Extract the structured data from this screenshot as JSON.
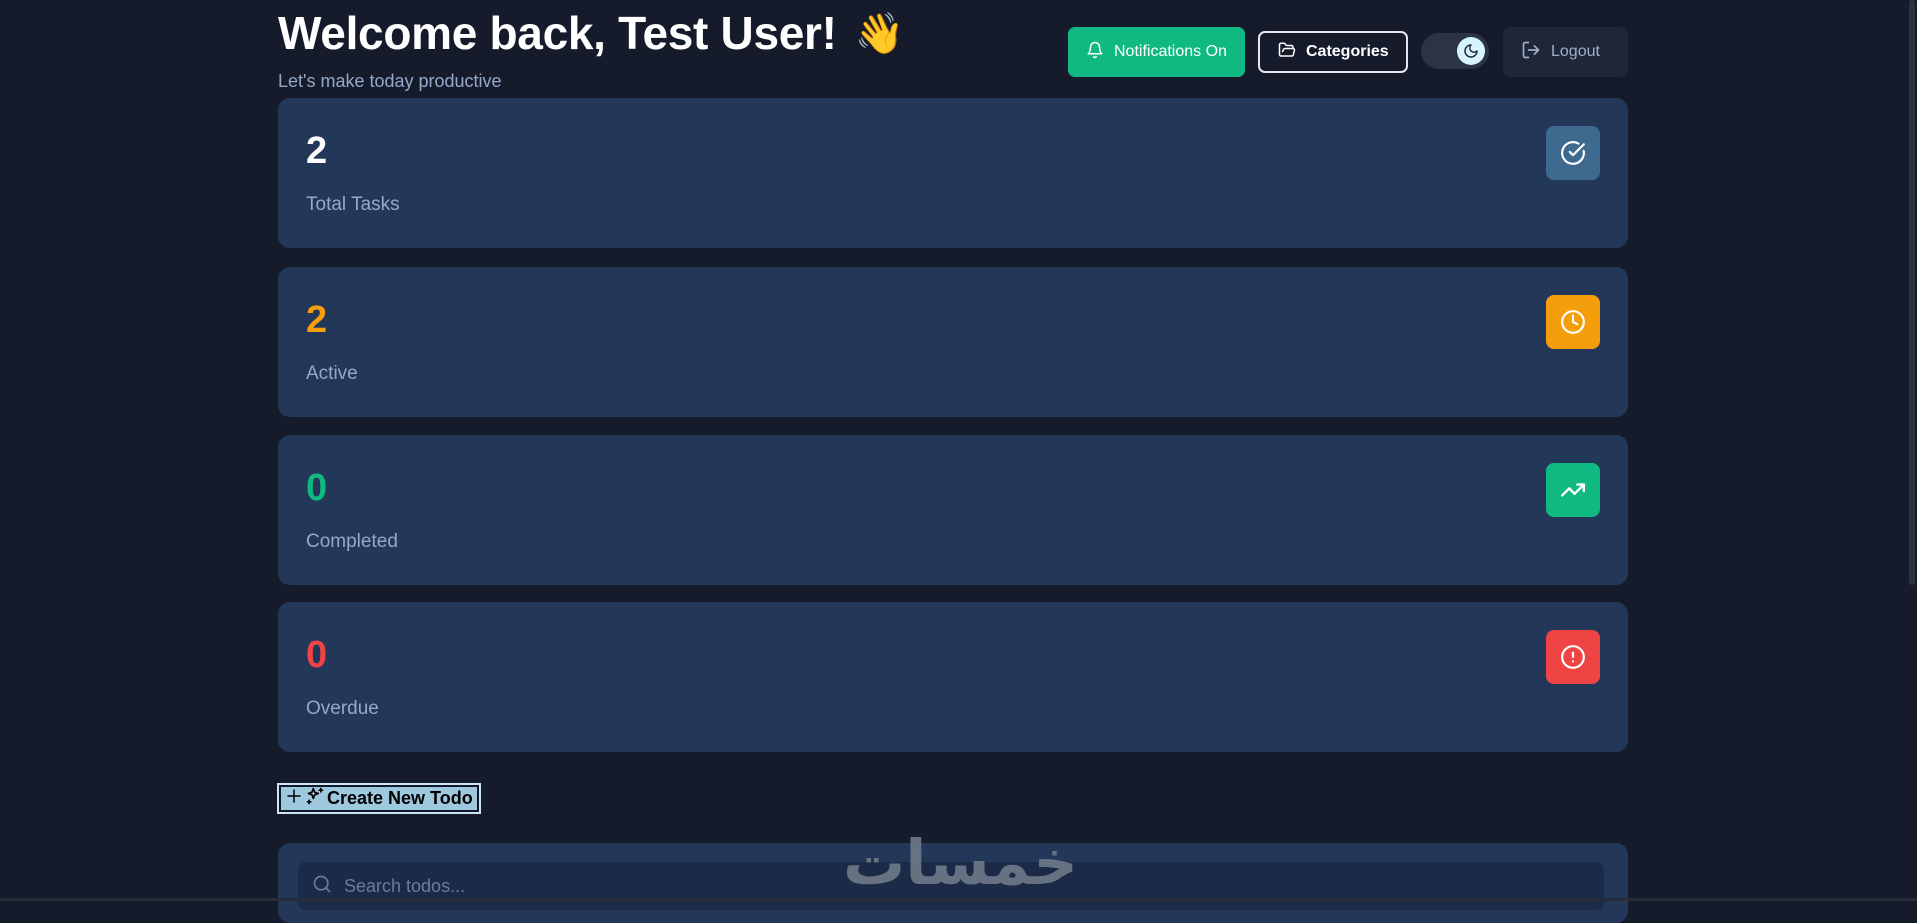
{
  "header": {
    "title": "Welcome back, Test User!",
    "wave": "👋",
    "subtitle": "Let's make today productive",
    "notifications_label": "Notifications On",
    "categories_label": "Categories",
    "logout_label": "Logout",
    "theme": "dark"
  },
  "stats": [
    {
      "value": "2",
      "label": "Total Tasks",
      "icon": "check-circle-icon",
      "color": "#ffffff",
      "icon_bg": "#3e6a8f"
    },
    {
      "value": "2",
      "label": "Active",
      "icon": "clock-icon",
      "color": "#f59e0b",
      "icon_bg": "#f59e0b"
    },
    {
      "value": "0",
      "label": "Completed",
      "icon": "trending-up-icon",
      "color": "#10b981",
      "icon_bg": "#10b981"
    },
    {
      "value": "0",
      "label": "Overdue",
      "icon": "alert-circle-icon",
      "color": "#ef4444",
      "icon_bg": "#ef4444"
    }
  ],
  "create_button": {
    "label": "Create New Todo"
  },
  "search": {
    "placeholder": "Search todos..."
  },
  "watermark": "خمسات"
}
